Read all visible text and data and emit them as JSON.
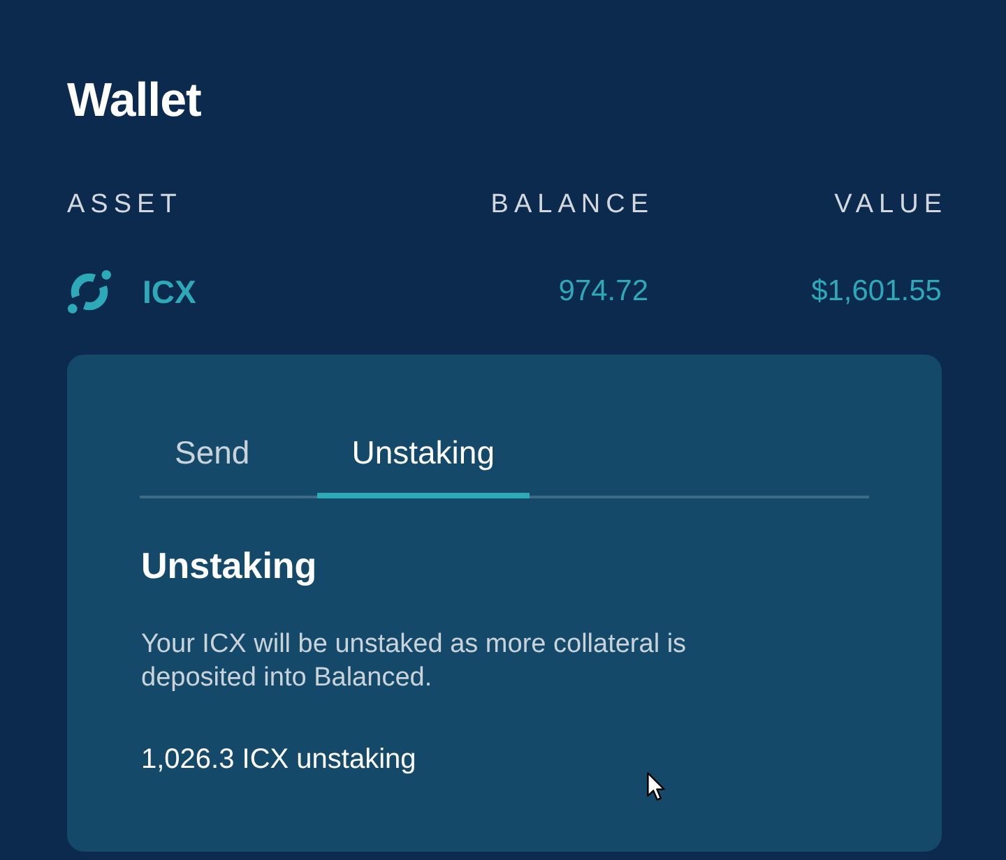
{
  "title": "Wallet",
  "table": {
    "columns": [
      "ASSET",
      "BALANCE",
      "VALUE"
    ],
    "rows": [
      {
        "asset": "ICX",
        "balance": "974.72",
        "value": "$1,601.55"
      }
    ]
  },
  "panel": {
    "tabs": [
      {
        "label": "Send",
        "selected": false
      },
      {
        "label": "Unstaking",
        "selected": true
      }
    ],
    "heading": "Unstaking",
    "description": "Your ICX will be unstaked as more collateral is deposited into Balanced.",
    "amount": "1,026.3 ICX unstaking"
  }
}
